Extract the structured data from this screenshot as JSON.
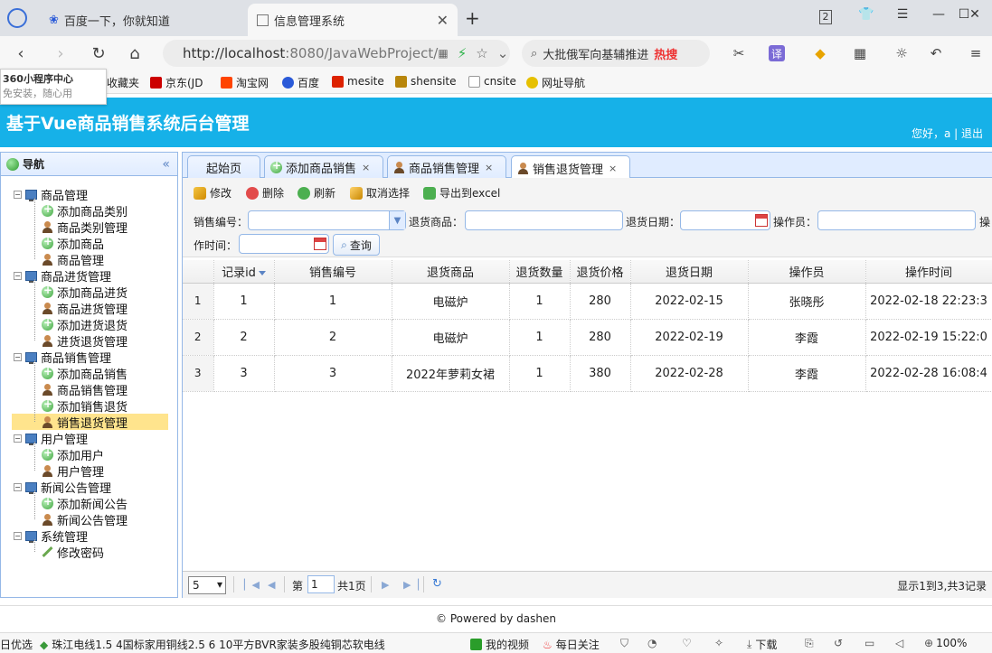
{
  "browser": {
    "tabs": [
      {
        "title": "百度一下，你就知道"
      },
      {
        "title": "信息管理系统"
      }
    ],
    "address": {
      "scheme_host": "http://localhost",
      "rest": ":8080/JavaWebProject/"
    },
    "search_hint": "大批俄军向基辅推进",
    "search_hot": "热搜",
    "tab_count": "2",
    "translate_label": "译",
    "popup": {
      "line1": "360小程序中心",
      "line2": "免安装，随心用"
    },
    "bookmarks": [
      {
        "label": "收藏夹",
        "icon": "star-icon"
      },
      {
        "label": "京东(JD",
        "icon": "jd-icon"
      },
      {
        "label": "淘宝网",
        "icon": "taobao-icon"
      },
      {
        "label": "百度",
        "icon": "baidu-icon"
      },
      {
        "label": "mesite",
        "icon": "mesite-icon"
      },
      {
        "label": "shensite",
        "icon": "shensite-icon"
      },
      {
        "label": "cnsite",
        "icon": "page-icon"
      },
      {
        "label": "网址导航",
        "icon": "nav-icon"
      }
    ]
  },
  "app": {
    "title": "基于Vue商品销售系统后台管理",
    "greeting": "您好，a | 退出",
    "footer": "© Powered by dashen"
  },
  "nav": {
    "title": "导航",
    "collapse": "«",
    "groups": [
      {
        "label": "商品管理",
        "items": [
          "添加商品类别",
          "商品类别管理",
          "添加商品",
          "商品管理"
        ]
      },
      {
        "label": "商品进货管理",
        "items": [
          "添加商品进货",
          "商品进货管理",
          "添加进货退货",
          "进货退货管理"
        ]
      },
      {
        "label": "商品销售管理",
        "items": [
          "添加商品销售",
          "商品销售管理",
          "添加销售退货",
          "销售退货管理"
        ]
      },
      {
        "label": "用户管理",
        "items": [
          "添加用户",
          "用户管理"
        ]
      },
      {
        "label": "新闻公告管理",
        "items": [
          "添加新闻公告",
          "新闻公告管理"
        ]
      },
      {
        "label": "系统管理",
        "items": [
          "修改密码"
        ]
      }
    ],
    "selected": "销售退货管理"
  },
  "content_tabs": [
    {
      "label": "起始页"
    },
    {
      "label": "添加商品销售",
      "close": "×"
    },
    {
      "label": "商品销售管理",
      "close": "×"
    },
    {
      "label": "销售退货管理",
      "close": "×"
    }
  ],
  "toolbar": {
    "edit": "修改",
    "delete": "删除",
    "refresh": "刷新",
    "deselect": "取消选择",
    "export": "导出到excel"
  },
  "filters": {
    "sale_no_label": "销售编号：",
    "goods_label": "退货商品：",
    "date_label": "退货日期：",
    "operator_label": "操作员：",
    "optime_label_1": "操",
    "optime_label_2": "作时间：",
    "query": "查询"
  },
  "grid": {
    "columns": [
      "记录id",
      "销售编号",
      "退货商品",
      "退货数量",
      "退货价格",
      "退货日期",
      "操作员",
      "操作时间"
    ],
    "rows": [
      [
        "1",
        "1",
        "1",
        "电磁炉",
        "1",
        "280",
        "2022-02-15",
        "张晓彤",
        "2022-02-18 22:23:3"
      ],
      [
        "2",
        "2",
        "2",
        "电磁炉",
        "1",
        "280",
        "2022-02-19",
        "李霞",
        "2022-02-19 15:22:0"
      ],
      [
        "3",
        "3",
        "3",
        "2022年萝莉女裙",
        "1",
        "380",
        "2022-02-28",
        "李霞",
        "2022-02-28 16:08:4"
      ]
    ]
  },
  "pager": {
    "page_size": "5",
    "page_prefix": "第",
    "page_value": "1",
    "page_total": "共1页",
    "summary": "显示1到3,共3记录"
  },
  "statusbar": {
    "left_cut": "日优选",
    "news": "珠江电线1.5 4国标家用铜线2.5 6 10平方BVR家装多股纯铜芯软电线",
    "video": "我的视频",
    "daily": "每日关注",
    "download": "下载",
    "zoom": "100%"
  }
}
